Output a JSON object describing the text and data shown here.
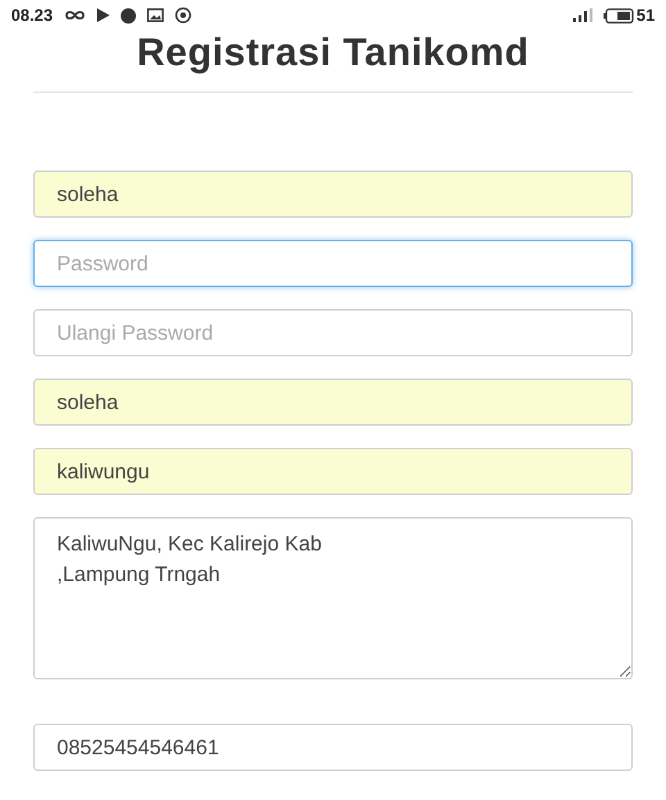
{
  "status_bar": {
    "time": "08.23",
    "battery": "51"
  },
  "title": "Registrasi Tanikomd",
  "fields": [
    {
      "kind": "input",
      "value": "soleha",
      "autofilled": true,
      "focused": false
    },
    {
      "kind": "input",
      "placeholder": "Password",
      "autofilled": false,
      "focused": true
    },
    {
      "kind": "input",
      "placeholder": "Ulangi Password",
      "autofilled": false,
      "focused": false
    },
    {
      "kind": "input",
      "value": "soleha",
      "autofilled": true,
      "focused": false
    },
    {
      "kind": "input",
      "value": "kaliwungu",
      "autofilled": true,
      "focused": false
    },
    {
      "kind": "textarea",
      "value": "KaliwuNgu, Kec Kalirejo Kab\n,Lampung Trngah",
      "autofilled": false,
      "focused": false
    },
    {
      "kind": "input",
      "value": "08525454546461",
      "autofilled": false,
      "focused": false
    }
  ]
}
